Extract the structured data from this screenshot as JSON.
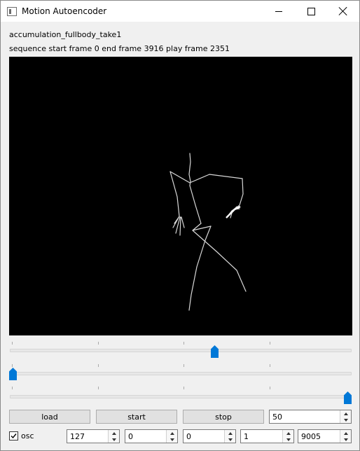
{
  "window": {
    "title": "Motion Autoencoder",
    "icon": "app-window-icon",
    "controls": [
      "minimize-icon",
      "maximize-icon",
      "close-icon"
    ]
  },
  "info": {
    "sequence_name": "accumulation_fullbody_take1",
    "frame_info": "sequence start frame 0 end frame 3916 play frame 2351"
  },
  "viewport": {
    "background": "#000000",
    "skeleton_color": "#d8d8d8"
  },
  "sliders": {
    "play_frame": {
      "min": 0,
      "max": 3916,
      "value": 2351
    },
    "slider_2": {
      "fraction": 0.0
    },
    "slider_3": {
      "fraction": 1.0
    }
  },
  "buttons": {
    "load": "load",
    "start": "start",
    "stop": "stop"
  },
  "spinboxes": {
    "top_right": "50",
    "row": [
      "127",
      "0",
      "0",
      "1",
      "9005"
    ]
  },
  "osc": {
    "label": "osc",
    "checked": true
  },
  "colors": {
    "accent": "#0078d7",
    "window_bg": "#f0f0f0"
  }
}
